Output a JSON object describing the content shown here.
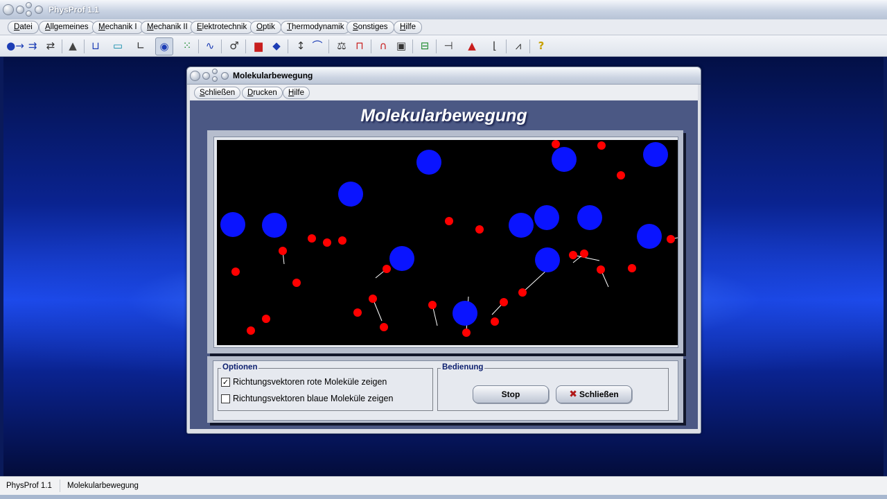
{
  "app": {
    "title": "PhysProf 1.1"
  },
  "menu": [
    "Datei",
    "Allgemeines",
    "Mechanik I",
    "Mechanik II",
    "Elektrotechnik",
    "Optik",
    "Thermodynamik",
    "Sonstiges",
    "Hilfe"
  ],
  "toolbar_icons": [
    "collision-icon",
    "balance-icon",
    "exchange-icon",
    "incline-icon",
    "container-icon",
    "lever-icon",
    "axes-icon",
    "eye-icon",
    "dots-grid-icon",
    "wave-icon",
    "gender-icon",
    "block-icon",
    "diamond-icon",
    "vertical-arrow-icon",
    "curve-icon",
    "scale-icon",
    "frame-icon",
    "magnet-icon",
    "plug-icon",
    "circuit-icon",
    "gauge-icon",
    "prism-icon",
    "decay-icon",
    "spectrum-icon",
    "help-icon"
  ],
  "dialog": {
    "title": "Molekularbewegung",
    "menu": [
      "Schließen",
      "Drucken",
      "Hilfe"
    ],
    "heading": "Molekularbewegung",
    "options": {
      "label": "Optionen",
      "red_vectors": {
        "label": "Richtungsvektoren rote Moleküle zeigen",
        "checked": true
      },
      "blue_vectors": {
        "label": "Richtungsvektoren blaue Moleküle zeigen",
        "checked": false
      }
    },
    "controls": {
      "label": "Bedienung",
      "stop": "Stop",
      "close": "Schließen"
    }
  },
  "status": {
    "app": "PhysProf 1.1",
    "module": "Molekularbewegung"
  },
  "colors": {
    "red_molecule": "#ff0000",
    "blue_molecule": "#0a14ff",
    "vector": "#ffffff",
    "canvas_bg": "#000000"
  }
}
